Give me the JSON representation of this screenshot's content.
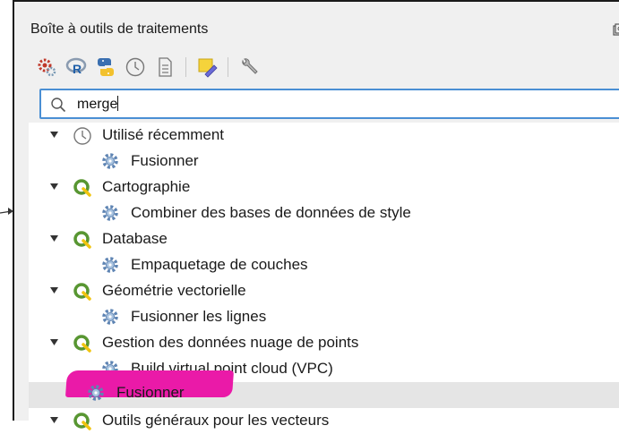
{
  "panel": {
    "title": "Boîte à outils de traitements"
  },
  "toolbar": {
    "icons": [
      "models-gear-icon",
      "r-icon",
      "python-icon",
      "history-clock-icon",
      "results-document-icon",
      "edit-pencil-icon",
      "options-wrench-icon"
    ]
  },
  "search": {
    "value": "merge"
  },
  "tree": [
    {
      "type": "group",
      "icon": "clock-icon",
      "label": "Utilisé récemment"
    },
    {
      "type": "algorithm",
      "icon": "gear-icon",
      "label": "Fusionner"
    },
    {
      "type": "group",
      "icon": "qgis-icon",
      "label": "Cartographie"
    },
    {
      "type": "algorithm",
      "icon": "gear-icon",
      "label": "Combiner des bases de données de style"
    },
    {
      "type": "group",
      "icon": "qgis-icon",
      "label": "Database"
    },
    {
      "type": "algorithm",
      "icon": "gear-icon",
      "label": "Empaquetage de couches"
    },
    {
      "type": "group",
      "icon": "qgis-icon",
      "label": "Géométrie vectorielle"
    },
    {
      "type": "algorithm",
      "icon": "gear-icon",
      "label": "Fusionner les lignes"
    },
    {
      "type": "group",
      "icon": "qgis-icon",
      "label": "Gestion des données nuage de points"
    },
    {
      "type": "algorithm",
      "icon": "gear-icon",
      "label": "Build virtual point cloud (VPC)"
    },
    {
      "type": "algorithm",
      "icon": "gear-icon",
      "label": "Fusionner",
      "selected": true,
      "annotation": "pink-marker-highlight"
    },
    {
      "type": "group",
      "icon": "qgis-icon",
      "label": "Outils généraux pour les vecteurs"
    }
  ],
  "colors": {
    "highlight": "#ea1aa8",
    "focus": "#4a8fd4",
    "qgis_green": "#589632"
  }
}
